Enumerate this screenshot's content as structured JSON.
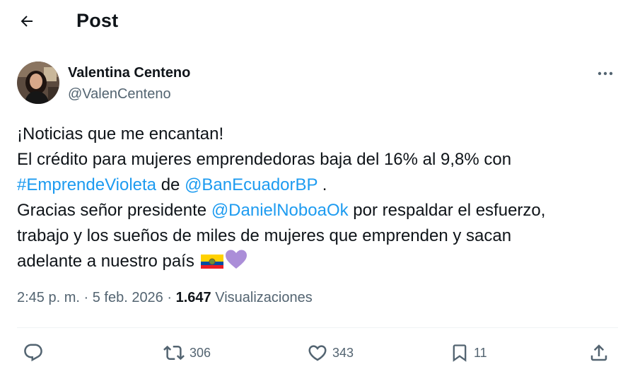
{
  "header": {
    "title": "Post"
  },
  "author": {
    "name": "Valentina Centeno",
    "handle": "@ValenCenteno"
  },
  "tweet": {
    "line1": "¡Noticias que me encantan!",
    "line2": "El crédito para mujeres emprendedoras baja del 16% al 9,8% con",
    "hashtag": "#EmprendeVioleta",
    "line3_mid": " de ",
    "mention1": "@BanEcuadorBP",
    "line3_end": " .",
    "line4_start": "Gracias señor presidente ",
    "mention2": "@DanielNoboaOk",
    "line4_end": " por respaldar el esfuerzo,",
    "line5": "trabajo y los sueños de miles de mujeres que emprenden y sacan",
    "line6": "adelante a nuestro país ",
    "emojis": [
      "ecuador-flag",
      "purple-heart"
    ]
  },
  "meta": {
    "time": "2:45 p. m.",
    "sep1": " · ",
    "date": "5 feb. 2026",
    "sep2": " · ",
    "views_count": "1.647",
    "views_label": " Visualizaciones"
  },
  "actions": {
    "replies": "",
    "reposts": "306",
    "likes": "343",
    "bookmarks": "11"
  },
  "colors": {
    "link": "#1d9bf0",
    "secondary_text": "#536471",
    "primary_text": "#0f1419",
    "divider": "#eff3f4",
    "heart_emoji": "#ab8ed8"
  },
  "icons": [
    "back-arrow-icon",
    "more-icon",
    "reply-icon",
    "repost-icon",
    "like-icon",
    "bookmark-icon",
    "share-icon"
  ]
}
